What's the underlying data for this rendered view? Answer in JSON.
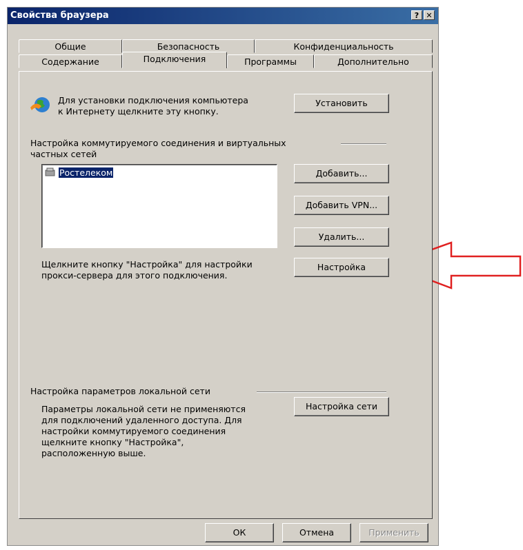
{
  "window": {
    "title": "Свойства браузера",
    "help_btn": "?",
    "close_btn": "✕"
  },
  "tabs_row1": [
    "Общие",
    "Безопасность",
    "Конфиденциальность"
  ],
  "tabs_row2": [
    "Содержание",
    "Подключения",
    "Программы",
    "Дополнительно"
  ],
  "active_tab": "Подключения",
  "setup": {
    "text": "Для установки подключения компьютера\nк Интернету щелкните эту кнопку.",
    "button_label": "Установить"
  },
  "dialup": {
    "header": "Настройка коммутируемого соединения и виртуальных\nчастных сетей",
    "connections": [
      "Ростелеком"
    ],
    "add_label": "Добавить...",
    "add_vpn_label": "Добавить VPN...",
    "remove_label": "Удалить...",
    "proxy_text": "Щелкните кнопку \"Настройка\" для настройки\nпрокси-сервера для этого подключения.",
    "settings_label": "Настройка"
  },
  "lan": {
    "header": "Настройка параметров локальной сети",
    "text": "Параметры локальной сети не применяются\nдля подключений удаленного доступа. Для\nнастройки коммутируемого соединения\nщелкните кнопку \"Настройка\",\nрасположенную выше.",
    "settings_label": "Настройка сети"
  },
  "footer": {
    "ok_label": "ОК",
    "cancel_label": "Отмена",
    "apply_label": "Применить"
  },
  "colors": {
    "title_bar": "#0a246a",
    "dialog_bg": "#d4d0c8",
    "annotation_arrow": "#e02020"
  }
}
